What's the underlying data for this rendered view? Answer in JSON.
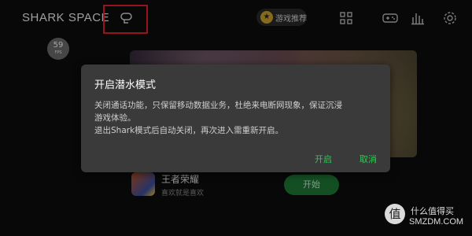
{
  "header": {
    "brand": "SHARK SPACE",
    "recommend_label": "游戏推荐",
    "icons": [
      "dive-mode-icon",
      "grid-icon",
      "gamepad-icon",
      "bar-chart-icon",
      "settings-icon"
    ]
  },
  "fps": {
    "value": "59",
    "unit": "FPS"
  },
  "game": {
    "name": "王者荣耀",
    "slogan": "喜欢就是喜欢",
    "start_label": "开始"
  },
  "dialog": {
    "title": "开启潜水模式",
    "body_line1": "关闭通话功能，只保留移动数据业务，杜绝来电断网现象，保证沉浸",
    "body_line2": "游戏体验。",
    "body_line3": "退出Shark模式后自动关闭，再次进入需重新开启。",
    "confirm_label": "开启",
    "cancel_label": "取消"
  },
  "watermark": {
    "badge": "值",
    "line1": "什么值得买",
    "line2": "SMZDM.COM"
  },
  "colors": {
    "accent_green": "#33c557",
    "highlight_red": "#e8202a",
    "dialog_bg": "#3a3a3a"
  }
}
